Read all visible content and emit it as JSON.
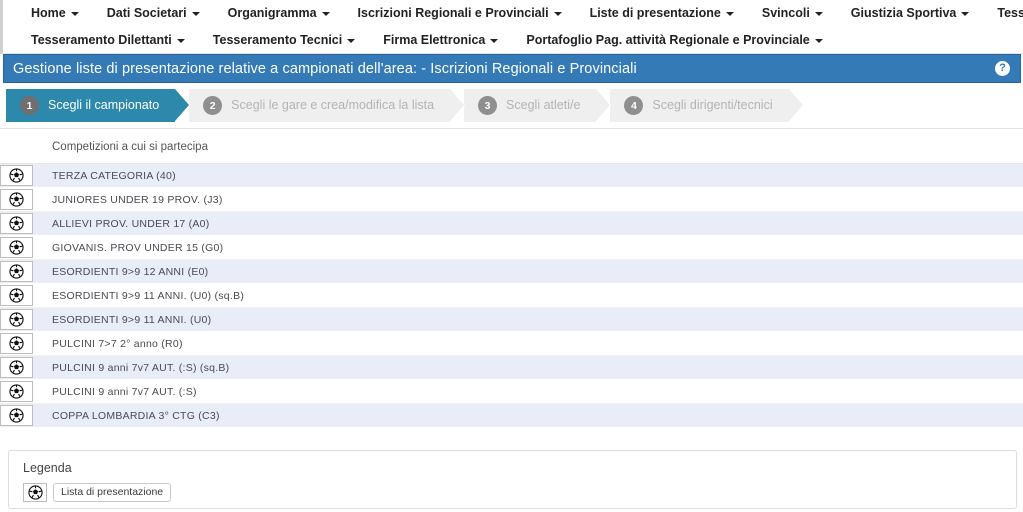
{
  "navbar": {
    "row1": [
      {
        "label": "Home",
        "icon": "chevron-down-icon"
      },
      {
        "label": "Dati Societari",
        "icon": "chevron-down-icon"
      },
      {
        "label": "Organigramma",
        "icon": "chevron-down-icon"
      },
      {
        "label": "Iscrizioni Regionali e Provinciali",
        "icon": "chevron-down-icon"
      },
      {
        "label": "Liste di presentazione",
        "icon": "chevron-down-icon"
      },
      {
        "label": "Svincoli",
        "icon": "chevron-down-icon"
      },
      {
        "label": "Giustizia Sportiva",
        "icon": "chevron-down-icon"
      },
      {
        "label": "Tesseramento SGS",
        "icon": "chevron-down-icon"
      }
    ],
    "row2": [
      {
        "label": "Tesseramento Dilettanti",
        "icon": "chevron-down-icon"
      },
      {
        "label": "Tesseramento Tecnici",
        "icon": "chevron-down-icon"
      },
      {
        "label": "Firma Elettronica",
        "icon": "chevron-down-icon"
      },
      {
        "label": "Portafoglio Pag. attività Regionale e Provinciale",
        "icon": "chevron-down-icon"
      }
    ]
  },
  "header": {
    "title": "Gestione liste di presentazione relative a campionati dell'area: - Iscrizioni Regionali e Provinciali",
    "help_label": "?",
    "background": "#337ab7"
  },
  "wizard": {
    "active_index": 0,
    "steps": [
      {
        "num": "1",
        "label": "Scegli il campionato"
      },
      {
        "num": "2",
        "label": "Scegli le gare e crea/modifica la lista"
      },
      {
        "num": "3",
        "label": "Scegli atleti/e"
      },
      {
        "num": "4",
        "label": "Scegli dirigenti/tecnici"
      }
    ]
  },
  "table": {
    "column_header": "Competizioni a cui si partecipa",
    "row_icon": "soccer-ball-icon",
    "rows": [
      {
        "name": "TERZA CATEGORIA  (40)"
      },
      {
        "name": "JUNIORES UNDER 19 PROV. (J3)"
      },
      {
        "name": "ALLIEVI PROV. UNDER 17 (A0)"
      },
      {
        "name": "GIOVANIS. PROV UNDER 15 (G0)"
      },
      {
        "name": "ESORDIENTI 9>9 12 ANNI (E0)"
      },
      {
        "name": "ESORDIENTI 9>9 11 ANNI. (U0)  (sq.B)"
      },
      {
        "name": "ESORDIENTI 9>9 11 ANNI. (U0)"
      },
      {
        "name": "PULCINI 7>7 2° anno (R0)"
      },
      {
        "name": "PULCINI 9 anni 7v7 AUT. (:S)  (sq.B)"
      },
      {
        "name": "PULCINI 9 anni 7v7 AUT. (:S)"
      },
      {
        "name": "COPPA LOMBARDIA 3° CTG (C3)"
      }
    ]
  },
  "legend": {
    "title": "Legenda",
    "items": [
      {
        "icon": "soccer-ball-icon",
        "label": "Lista di presentazione"
      }
    ]
  }
}
